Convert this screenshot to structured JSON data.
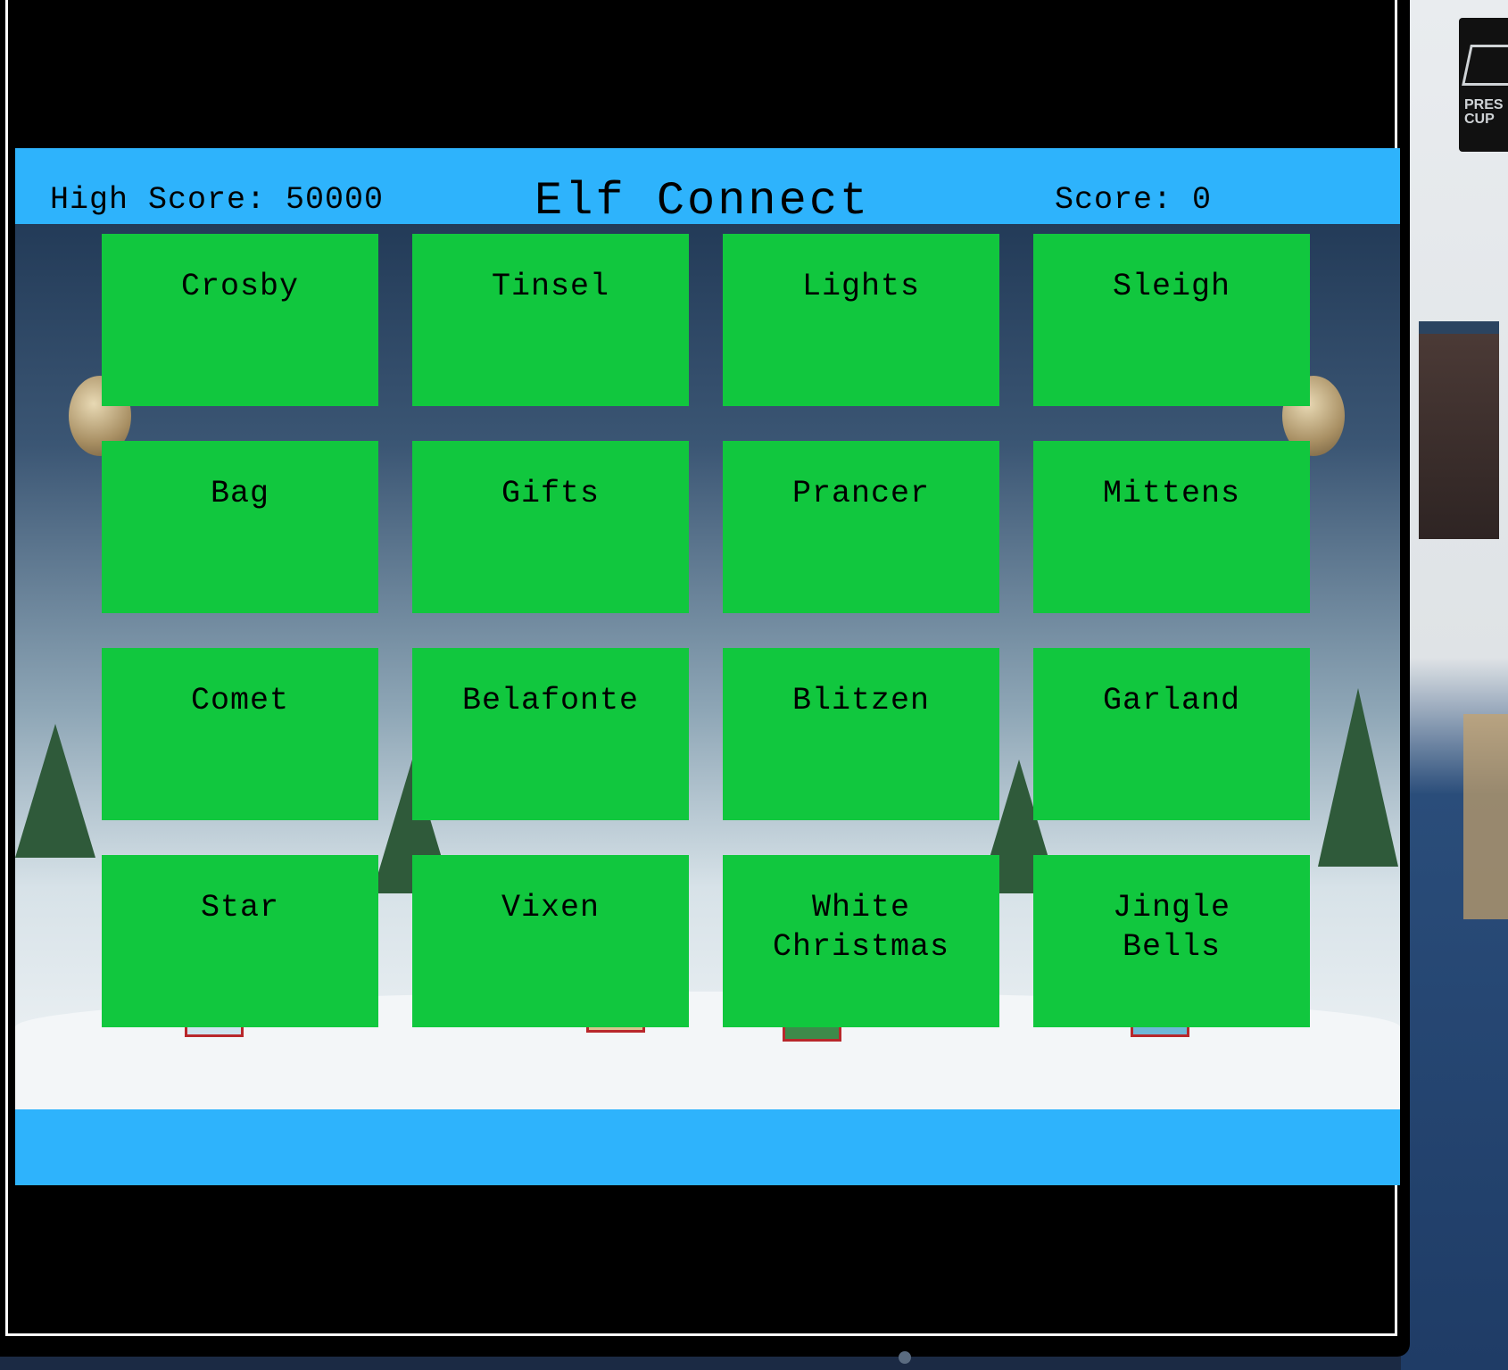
{
  "hud": {
    "high_score_label": "High Score: 50000",
    "title": "Elf Connect",
    "score_label": "Score: 0"
  },
  "tiles": [
    "Crosby",
    "Tinsel",
    "Lights",
    "Sleigh",
    "Bag",
    "Gifts",
    "Prancer",
    "Mittens",
    "Comet",
    "Belafonte",
    "Blitzen",
    "Garland",
    "Star",
    "Vixen",
    "White\nChristmas",
    "Jingle\nBells"
  ],
  "side_scene": {
    "sign_text": "PRES\nCUP"
  },
  "colors": {
    "tile": "#11c73e",
    "bar": "#2eb3fc"
  }
}
